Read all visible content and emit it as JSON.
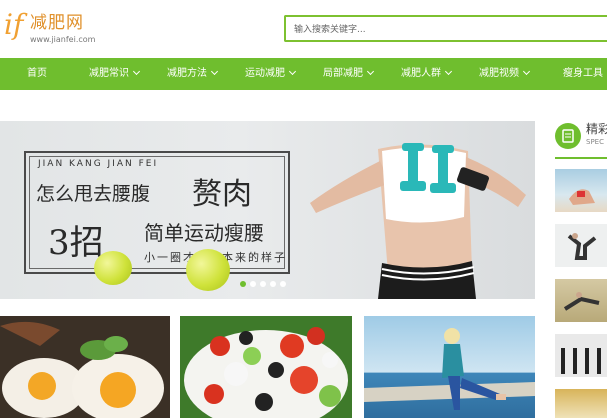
{
  "site": {
    "logo_mark": "if",
    "logo_name": "减肥网",
    "logo_domain": "www.jianfei.com"
  },
  "search": {
    "placeholder": "输入搜索关键字..."
  },
  "nav": {
    "items": [
      {
        "label": "首页",
        "dropdown": false
      },
      {
        "label": "减肥常识",
        "dropdown": true
      },
      {
        "label": "减肥方法",
        "dropdown": true
      },
      {
        "label": "运动减肥",
        "dropdown": true
      },
      {
        "label": "局部减肥",
        "dropdown": true
      },
      {
        "label": "减肥人群",
        "dropdown": true
      },
      {
        "label": "减肥视频",
        "dropdown": true
      },
      {
        "label": "瘦身工具",
        "dropdown": false
      }
    ]
  },
  "banner": {
    "pinyin": "JIAN KANG JIAN FEI",
    "line1": "怎么甩去腰腹",
    "line1_big": "赘肉",
    "line2_big": "3招",
    "line2": "简单运动瘦腰",
    "line3": "小一圈才是你本来的样子",
    "slides": 5,
    "active_slide": 1
  },
  "sidebar": {
    "title": "精彩",
    "subtitle": "SPEC"
  },
  "colors": {
    "brand_green": "#6fbe2e",
    "logo_orange": "#f0a032"
  }
}
